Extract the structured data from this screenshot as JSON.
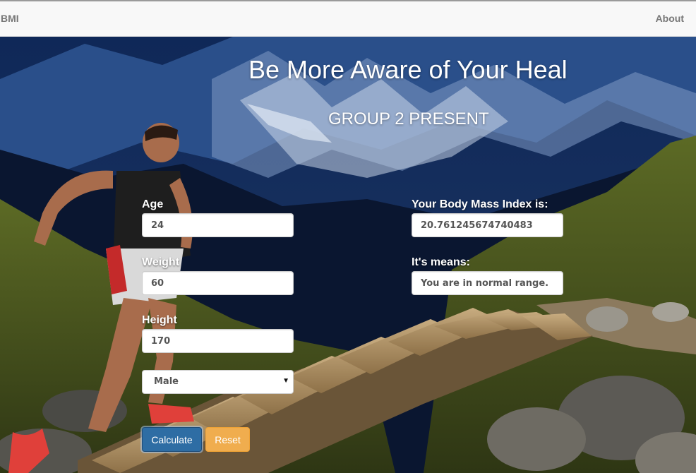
{
  "navbar": {
    "brand": "BMI",
    "about": "About"
  },
  "hero": {
    "title": "Be More Aware of Your Heal",
    "subtitle": "GROUP 2 PRESENT"
  },
  "form": {
    "age": {
      "label": "Age",
      "value": "24"
    },
    "weight": {
      "label": "Weight",
      "value": "60"
    },
    "height": {
      "label": "Height",
      "value": "170"
    },
    "gender": {
      "selected": "Male"
    },
    "calculate_label": "Calculate",
    "reset_label": "Reset"
  },
  "result": {
    "bmi_label": "Your Body Mass Index is:",
    "bmi_value": "20.761245674740483",
    "meaning_label": "It's means:",
    "meaning_value": "You are in normal range."
  },
  "colors": {
    "navbar_bg": "#f8f8f8",
    "primary_button": "#2e6da4",
    "warning_button": "#f0ad4e",
    "text_on_hero": "#ffffff"
  }
}
